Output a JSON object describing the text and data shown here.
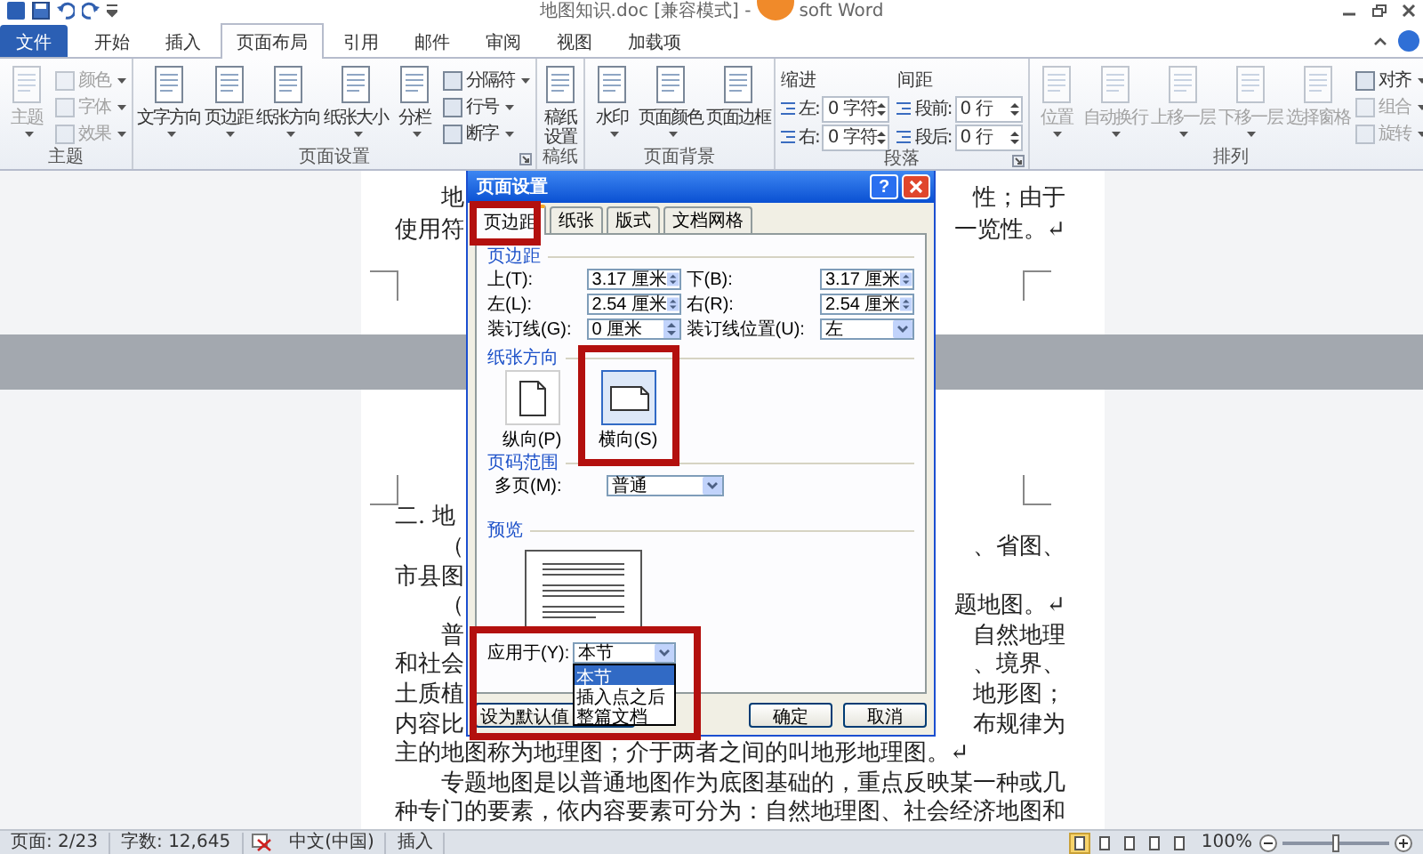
{
  "window": {
    "title": "地图知识.doc [兼容模式] -",
    "title_tail": "soft Word"
  },
  "tabs": [
    {
      "label": "文件",
      "kind": "file",
      "selected": false
    },
    {
      "label": "开始",
      "kind": "tab",
      "selected": false
    },
    {
      "label": "插入",
      "kind": "tab",
      "selected": false
    },
    {
      "label": "页面布局",
      "kind": "tab",
      "selected": true
    },
    {
      "label": "引用",
      "kind": "tab",
      "selected": false
    },
    {
      "label": "邮件",
      "kind": "tab",
      "selected": false
    },
    {
      "label": "审阅",
      "kind": "tab",
      "selected": false
    },
    {
      "label": "视图",
      "kind": "tab",
      "selected": false
    },
    {
      "label": "加载项",
      "kind": "tab",
      "selected": false
    }
  ],
  "ribbon_groups": [
    {
      "label": "主题",
      "launcher": false,
      "items": [
        {
          "kind": "large",
          "label": "主题",
          "dropdown": true,
          "disabled": true
        },
        {
          "kind": "stack",
          "buttons": [
            {
              "label": "颜色",
              "disabled": true
            },
            {
              "label": "字体",
              "disabled": true
            },
            {
              "label": "效果",
              "disabled": true
            }
          ]
        }
      ]
    },
    {
      "label": "页面设置",
      "launcher": true,
      "items": [
        {
          "kind": "large",
          "label": "文字方向",
          "dropdown": true,
          "disabled": false
        },
        {
          "kind": "large",
          "label": "页边距",
          "dropdown": true,
          "disabled": false
        },
        {
          "kind": "large",
          "label": "纸张方向",
          "dropdown": true,
          "disabled": false
        },
        {
          "kind": "large",
          "label": "纸张大小",
          "dropdown": true,
          "disabled": false
        },
        {
          "kind": "large",
          "label": "分栏",
          "dropdown": true,
          "disabled": false
        },
        {
          "kind": "stack",
          "buttons": [
            {
              "label": "分隔符",
              "disabled": false
            },
            {
              "label": "行号",
              "disabled": false
            },
            {
              "label": "断字",
              "disabled": false
            }
          ]
        }
      ]
    },
    {
      "label": "稿纸",
      "launcher": false,
      "items": [
        {
          "kind": "large",
          "label": "稿纸设置",
          "dropdown": false,
          "disabled": false
        }
      ]
    },
    {
      "label": "页面背景",
      "launcher": false,
      "items": [
        {
          "kind": "large",
          "label": "水印",
          "dropdown": true,
          "disabled": false
        },
        {
          "kind": "large",
          "label": "页面颜色",
          "dropdown": true,
          "disabled": false
        },
        {
          "kind": "large",
          "label": "页面边框",
          "dropdown": false,
          "disabled": false
        }
      ]
    },
    {
      "label": "段落",
      "launcher": true,
      "items": [
        {
          "kind": "spin_column",
          "heading": "缩进",
          "fields": [
            {
              "label": "左:",
              "value": "0 字符"
            },
            {
              "label": "右:",
              "value": "0 字符"
            }
          ]
        },
        {
          "kind": "spin_column",
          "heading": "间距",
          "fields": [
            {
              "label": "段前:",
              "value": "0 行"
            },
            {
              "label": "段后:",
              "value": "0 行"
            }
          ]
        }
      ]
    },
    {
      "label": "排列",
      "launcher": false,
      "items": [
        {
          "kind": "large",
          "label": "位置",
          "dropdown": true,
          "disabled": true
        },
        {
          "kind": "large",
          "label": "自动换行",
          "dropdown": true,
          "disabled": true
        },
        {
          "kind": "large",
          "label": "上移一层",
          "dropdown": true,
          "disabled": true
        },
        {
          "kind": "large",
          "label": "下移一层",
          "dropdown": true,
          "disabled": true
        },
        {
          "kind": "large",
          "label": "选择窗格",
          "dropdown": false,
          "disabled": true
        },
        {
          "kind": "stack",
          "buttons": [
            {
              "label": "对齐",
              "disabled": false
            },
            {
              "label": "组合",
              "disabled": true
            },
            {
              "label": "旋转",
              "disabled": true
            }
          ]
        }
      ]
    }
  ],
  "document": {
    "pages": [
      {
        "lines": [
          {
            "left": "地",
            "right": "性；由于",
            "indent": true
          },
          {
            "left": "使用符",
            "right": "一览性。↵",
            "indent": false
          }
        ]
      },
      {
        "lines": [
          {
            "left": "二. 地",
            "indent": false
          },
          {
            "left": "（",
            "right": "、省图、",
            "indent": true
          },
          {
            "left": "市县图",
            "indent": false
          },
          {
            "left": "（",
            "right": "题地图。↵",
            "indent": true
          },
          {
            "left": "普",
            "right": "自然地理",
            "indent": true
          },
          {
            "left": "和社会",
            "right": "、境界、",
            "indent": false
          },
          {
            "left": "土质植",
            "right": "地形图；",
            "indent": false
          },
          {
            "left": "内容比",
            "right": "布规律为",
            "indent": false
          },
          {
            "left": "主的地图称为地理图；介于两者之间的叫地形地理图。↵",
            "indent": false
          },
          {
            "left": "专题地图是以普通地图作为底图基础的，重点反映某一种或几",
            "indent": true
          },
          {
            "left": "种专门的要素，依内容要素可分为：自然地理图、社会经济地图和",
            "indent": false
          }
        ]
      }
    ]
  },
  "dialog": {
    "title": "页面设置",
    "help_button": "?",
    "tabs": [
      {
        "label": "页边距",
        "selected": true
      },
      {
        "label": "纸张",
        "selected": false
      },
      {
        "label": "版式",
        "selected": false
      },
      {
        "label": "文档网格",
        "selected": false
      }
    ],
    "margins": {
      "heading": "页边距",
      "fields": [
        {
          "label": "上(T):",
          "value": "3.17 厘米",
          "kind": "spin"
        },
        {
          "label": "下(B):",
          "value": "3.17 厘米",
          "kind": "spin"
        },
        {
          "label": "左(L):",
          "value": "2.54 厘米",
          "kind": "spin"
        },
        {
          "label": "右(R):",
          "value": "2.54 厘米",
          "kind": "spin"
        },
        {
          "label": "装订线(G):",
          "value": "0 厘米",
          "kind": "spin"
        },
        {
          "label": "装订线位置(U):",
          "value": "左",
          "kind": "combo"
        }
      ]
    },
    "orientation": {
      "heading": "纸张方向",
      "options": [
        {
          "label": "纵向(P)",
          "kind": "portrait",
          "selected": false
        },
        {
          "label": "横向(S)",
          "kind": "landscape",
          "selected": true
        }
      ]
    },
    "page_range": {
      "heading": "页码范围",
      "label": "多页(M):",
      "value": "普通"
    },
    "preview": {
      "heading": "预览"
    },
    "apply_to": {
      "label": "应用于(Y):",
      "value": "本节",
      "expanded": true,
      "options": [
        {
          "label": "本节",
          "selected": true
        },
        {
          "label": "插入点之后",
          "selected": false
        },
        {
          "label": "整篇文档",
          "selected": false
        }
      ]
    },
    "buttons": [
      {
        "label": "设为默认值",
        "kind": "default"
      },
      {
        "label": "确定",
        "kind": "ok"
      },
      {
        "label": "取消",
        "kind": "cancel"
      }
    ]
  },
  "status_bar": {
    "items": [
      {
        "label": "页面: 2/23"
      },
      {
        "label": "字数: 12,645"
      },
      {
        "label": "中文(中国)"
      },
      {
        "label": "插入"
      }
    ],
    "view_buttons": [
      {
        "selected": true
      },
      {
        "selected": false
      },
      {
        "selected": false
      },
      {
        "selected": false
      },
      {
        "selected": false
      }
    ],
    "zoom": "100%",
    "zoom_slider": {
      "level": 0.5
    }
  }
}
